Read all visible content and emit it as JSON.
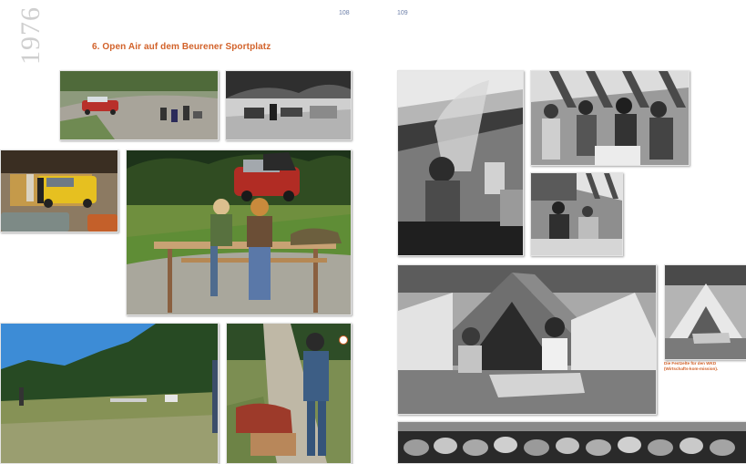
{
  "book": {
    "year": "1976",
    "page_left": "108",
    "page_right": "109",
    "section_title": "6. Open Air auf dem Beurener Sportplatz",
    "caption": "Die Festzelte für den WKD (Wirtschafts-kom-mission)."
  }
}
